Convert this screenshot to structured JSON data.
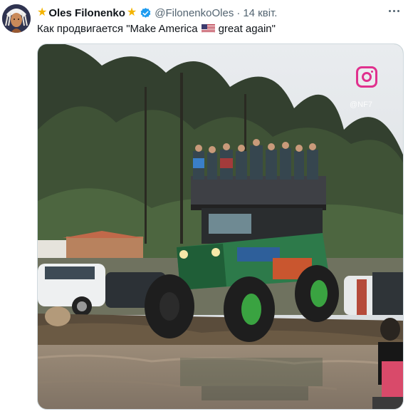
{
  "tweet": {
    "avatar_icon": "avatar-icon",
    "display_name": "Oles Filonenko",
    "name_emoji_left": "★",
    "name_emoji_right": "★",
    "verified_icon": "verified-badge-icon",
    "handle": "@FilonenkoOles",
    "separator": "·",
    "date": "14 квіт.",
    "more_icon": "more-options-icon",
    "text_before_flag": "Как продвигается \"Make America",
    "flag_icon": "us-flag-icon",
    "text_after_flag": "great again\""
  },
  "media": {
    "watermark_icon": "instagram-icon",
    "watermark_handle": "@NF7"
  },
  "colors": {
    "star": "#f4b400",
    "verified": "#1d9bf0",
    "secondary_text": "#536471",
    "instagram": "#e0318e"
  }
}
